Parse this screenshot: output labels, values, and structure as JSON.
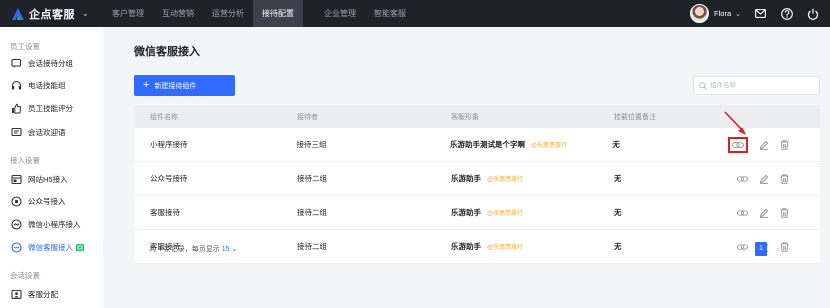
{
  "brand": {
    "name": "企点客服",
    "logo": "a-logo-icon"
  },
  "nav": {
    "items": [
      {
        "label": "客户管理",
        "active": false
      },
      {
        "label": "互动营销",
        "active": false
      },
      {
        "label": "运营分析",
        "active": false
      },
      {
        "label": "接待配置",
        "active": true
      },
      {
        "label": "企业管理",
        "active": false
      },
      {
        "label": "智能客服",
        "active": false
      }
    ]
  },
  "user": {
    "name": "Flora"
  },
  "sidebar": {
    "groups": [
      {
        "title": "员工设置",
        "items": [
          {
            "label": "会话接待分组",
            "icon": "chat-icon"
          },
          {
            "label": "电话技能组",
            "icon": "headset-icon"
          },
          {
            "label": "员工技能评分",
            "icon": "thumb-icon"
          },
          {
            "label": "会话欢迎语",
            "icon": "message-icon"
          }
        ]
      },
      {
        "title": "接入设置",
        "items": [
          {
            "label": "网站H5接入",
            "icon": "web-icon"
          },
          {
            "label": "公众号接入",
            "icon": "official-account-icon"
          },
          {
            "label": "微信小程序接入",
            "icon": "miniprogram-icon"
          },
          {
            "label": "微信客服接入",
            "icon": "wechat-service-icon",
            "active": true
          }
        ]
      },
      {
        "title": "会话设置",
        "items": [
          {
            "label": "客服分配",
            "icon": "assign-icon"
          }
        ]
      }
    ]
  },
  "main": {
    "title": "微信客服接入",
    "create_button": "新建接待组件",
    "search_placeholder": "组件名称",
    "columns": [
      "组件名称",
      "接待者",
      "客服形象",
      "挂载位置备注"
    ],
    "rows": [
      {
        "name": "小程序接待",
        "receiver": "接待三组",
        "avatar_name": "乐游助手测试是个字啊",
        "tag": "@乐悠悠旅行",
        "note": "无"
      },
      {
        "name": "公众号接待",
        "receiver": "接待二组",
        "avatar_name": "乐游助手",
        "tag": "@乐悠悠旅行",
        "note": "无"
      },
      {
        "name": "客服接待",
        "receiver": "接待二组",
        "avatar_name": "乐游助手",
        "tag": "@乐悠悠旅行",
        "note": "无"
      },
      {
        "name": "客服接待",
        "receiver": "接待二组",
        "avatar_name": "乐游助手",
        "tag": "@乐悠悠旅行",
        "note": "无"
      }
    ],
    "footer": {
      "total_text": "共 4 条记录，每页显示",
      "per_page": "15",
      "current_page": "1"
    }
  },
  "colors": {
    "accent": "#2f6bff",
    "topbar": "#1e2229",
    "tag": "#f0a83a",
    "highlight": "#e02020",
    "badge": "#27c26c"
  }
}
